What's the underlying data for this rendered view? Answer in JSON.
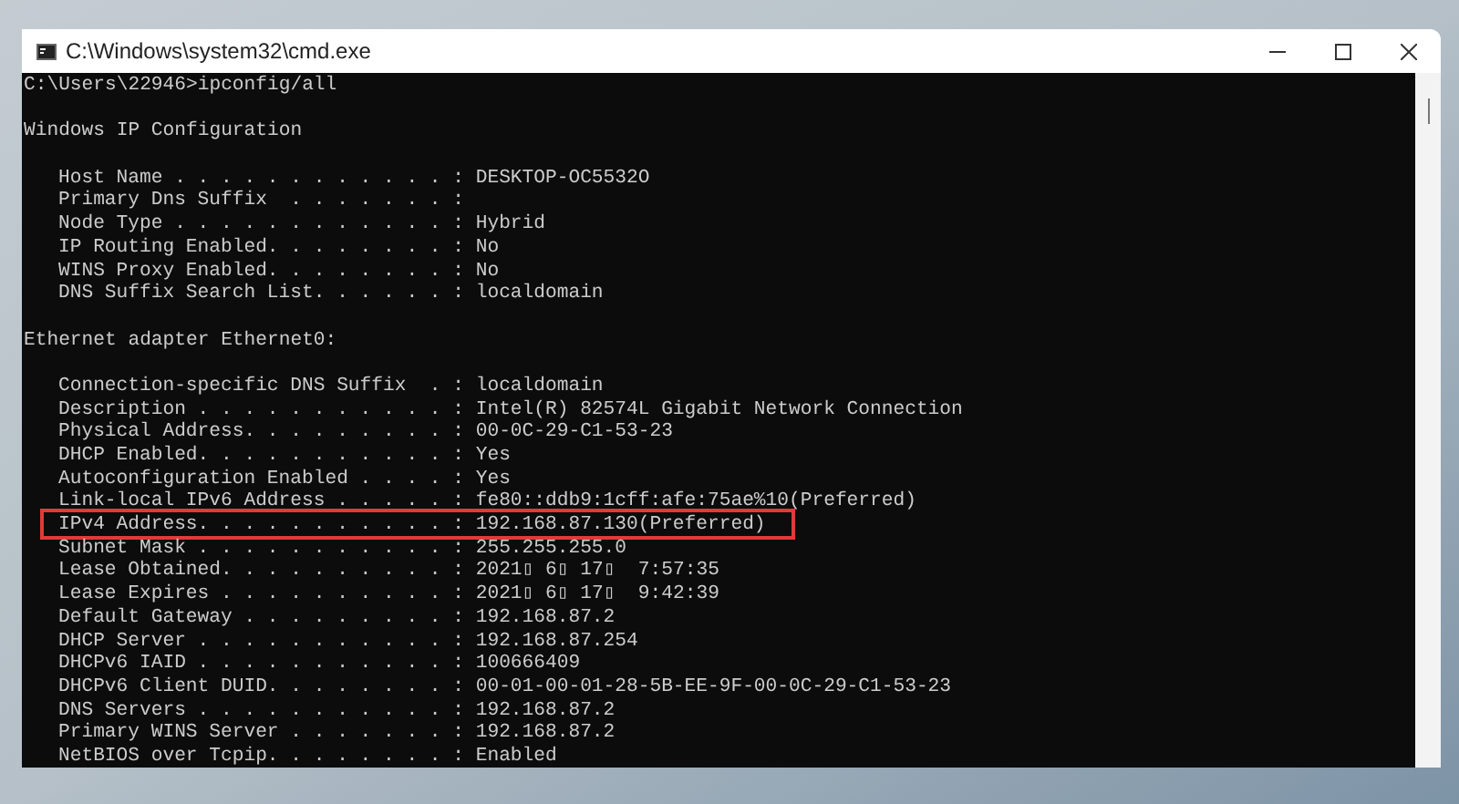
{
  "window": {
    "title": "C:\\Windows\\system32\\cmd.exe"
  },
  "console": {
    "command": "C:\\Users\\22946>ipconfig/all",
    "sections": [
      {
        "heading": "Windows IP Configuration",
        "lines": [
          {
            "text": "Host Name . . . . . . . . . . . . : DESKTOP-OC5532O",
            "highlighted": false
          },
          {
            "text": "Primary Dns Suffix  . . . . . . . :",
            "highlighted": false
          },
          {
            "text": "Node Type . . . . . . . . . . . . : Hybrid",
            "highlighted": false
          },
          {
            "text": "IP Routing Enabled. . . . . . . . : No",
            "highlighted": false
          },
          {
            "text": "WINS Proxy Enabled. . . . . . . . : No",
            "highlighted": false
          },
          {
            "text": "DNS Suffix Search List. . . . . . : localdomain",
            "highlighted": false
          }
        ]
      },
      {
        "heading": "Ethernet adapter Ethernet0:",
        "lines": [
          {
            "text": "Connection-specific DNS Suffix  . : localdomain",
            "highlighted": false
          },
          {
            "text": "Description . . . . . . . . . . . : Intel(R) 82574L Gigabit Network Connection",
            "highlighted": false
          },
          {
            "text": "Physical Address. . . . . . . . . : 00-0C-29-C1-53-23",
            "highlighted": false
          },
          {
            "text": "DHCP Enabled. . . . . . . . . . . : Yes",
            "highlighted": false
          },
          {
            "text": "Autoconfiguration Enabled . . . . : Yes",
            "highlighted": false
          },
          {
            "text": "Link-local IPv6 Address . . . . . : fe80::ddb9:1cff:afe:75ae%10(Preferred)",
            "highlighted": false
          },
          {
            "text": "IPv4 Address. . . . . . . . . . . : 192.168.87.130(Preferred)",
            "highlighted": true
          },
          {
            "text": "Subnet Mask . . . . . . . . . . . : 255.255.255.0",
            "highlighted": false
          },
          {
            "text": "Lease Obtained. . . . . . . . . . : 2021▯ 6▯ 17▯  7:57:35",
            "highlighted": false
          },
          {
            "text": "Lease Expires . . . . . . . . . . : 2021▯ 6▯ 17▯  9:42:39",
            "highlighted": false
          },
          {
            "text": "Default Gateway . . . . . . . . . : 192.168.87.2",
            "highlighted": false
          },
          {
            "text": "DHCP Server . . . . . . . . . . . : 192.168.87.254",
            "highlighted": false
          },
          {
            "text": "DHCPv6 IAID . . . . . . . . . . . : 100666409",
            "highlighted": false
          },
          {
            "text": "DHCPv6 Client DUID. . . . . . . . : 00-01-00-01-28-5B-EE-9F-00-0C-29-C1-53-23",
            "highlighted": false
          },
          {
            "text": "DNS Servers . . . . . . . . . . . : 192.168.87.2",
            "highlighted": false
          },
          {
            "text": "Primary WINS Server . . . . . . . : 192.168.87.2",
            "highlighted": false
          },
          {
            "text": "NetBIOS over Tcpip. . . . . . . . : Enabled",
            "highlighted": false
          }
        ]
      }
    ]
  }
}
